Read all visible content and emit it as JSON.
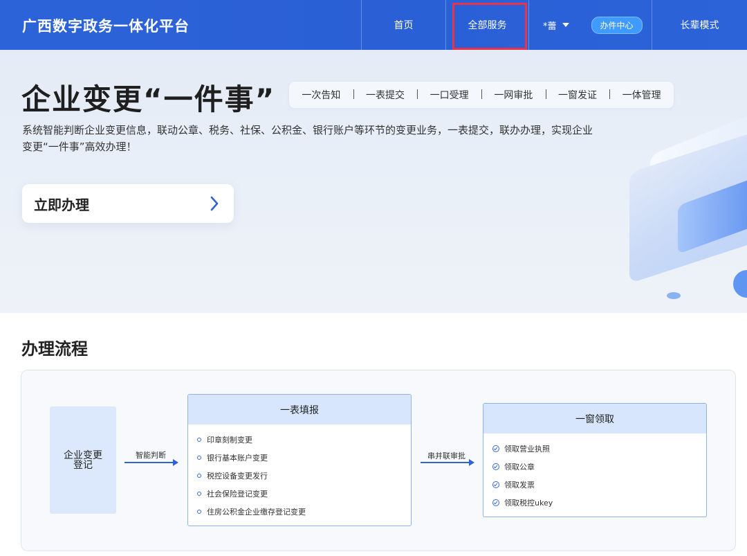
{
  "header": {
    "logo": "广西数字政务一体化平台",
    "nav": {
      "home": "首页",
      "all_services": "全部服务",
      "username": "*蕾",
      "office_center": "办件中心",
      "elder_mode": "长辈模式"
    }
  },
  "hero": {
    "title": "企业变更“一件事”",
    "tags": [
      "一次告知",
      "一表提交",
      "一口受理",
      "一网审批",
      "一窗发证",
      "一体管理"
    ],
    "description": "系统智能判断企业变更信息，联动公章、税务、社保、公积金、银行账户等环节的变更业务，一表提交，联办办理，实现企业变更“一件事”高效办理！",
    "cta": "立即办理"
  },
  "process": {
    "title": "办理流程",
    "start": "企业变更登记",
    "arrow1": "智能判断",
    "form_card": {
      "title": "一表填报",
      "items": [
        "印章刻制变更",
        "银行基本账户变更",
        "税控设备变更发行",
        "社会保险登记变更",
        "住房公积金企业缴存登记变更"
      ]
    },
    "arrow2": "串并联审批",
    "window_card": {
      "title": "一窗领取",
      "items": [
        "领取营业执照",
        "领取公章",
        "领取发票",
        "领取税控ukey"
      ]
    }
  },
  "colors": {
    "header_bg": "#2d63d8",
    "accent": "#2f63d2",
    "highlight_border": "#e8344a",
    "office_badge": "#3f9bff"
  }
}
